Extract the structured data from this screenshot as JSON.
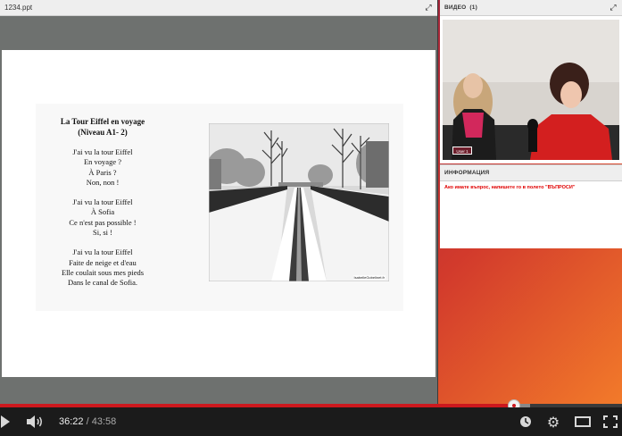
{
  "presentation": {
    "title": "1234.ppt"
  },
  "slide": {
    "poem_title": "La Tour Eiffel en voyage",
    "poem_level": "(Niveau A1- 2)",
    "stanzas": [
      [
        "J'ai vu la tour Eiffel",
        "En voyage ?",
        "À Paris ?",
        "Non, non !"
      ],
      [
        "J'ai vu la tour Eiffel",
        "À Sofia",
        "Ce n'est pas possible !",
        "Si, si !"
      ],
      [
        "J'ai vu la tour Eiffel",
        "Faite de neige et d'eau",
        "Elle coulait sous mes pieds",
        "Dans le canal de Sofia."
      ]
    ],
    "photo_credit": "IsabelleGobelinet.fr"
  },
  "video_panel": {
    "title": "ВИДЕО",
    "count": "(1)",
    "user_label": "User 1"
  },
  "info_panel": {
    "title": "ИНФОРМАЦИЯ",
    "message": "Ако имате въпрос, напишете го в полето \"ВЪПРОСИ\""
  },
  "player": {
    "current_time": "36:22",
    "duration": "43:58",
    "separator": " / ",
    "progress_fraction": 0.827,
    "accent_color": "#cc181e"
  },
  "icons": [
    "expand-icon",
    "play-icon",
    "volume-icon",
    "watch-later-icon",
    "gear-icon",
    "theater-icon",
    "fullscreen-icon"
  ]
}
